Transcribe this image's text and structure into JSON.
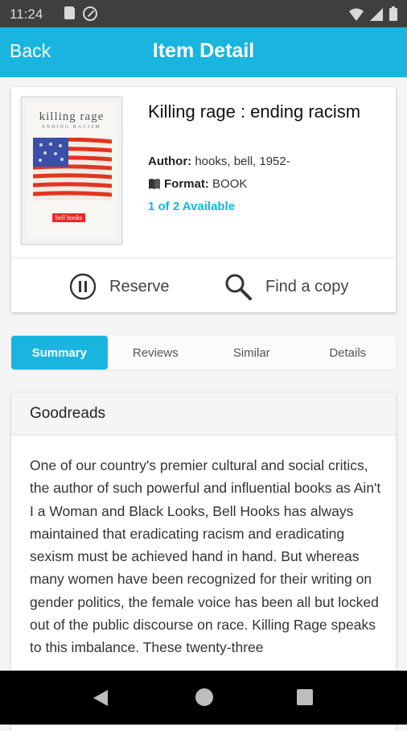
{
  "status_bar": {
    "time": "11:24"
  },
  "header": {
    "back_label": "Back",
    "title": "Item Detail"
  },
  "item": {
    "title": "Killing rage : ending racism",
    "author_label": "Author:",
    "author_value": "hooks, bell, 1952-",
    "format_label": "Format:",
    "format_value": "BOOK",
    "availability": "1 of 2 Available",
    "cover": {
      "title": "killing rage",
      "subtitle": "ENDING RACISM",
      "author": "bell hooks"
    }
  },
  "actions": {
    "reserve_label": "Reserve",
    "find_label": "Find a copy"
  },
  "tabs": [
    {
      "label": "Summary",
      "active": true
    },
    {
      "label": "Reviews",
      "active": false
    },
    {
      "label": "Similar",
      "active": false
    },
    {
      "label": "Details",
      "active": false
    }
  ],
  "summary": {
    "heading": "Goodreads",
    "text": "One of our country's premier cultural and social critics, the author of such powerful and influential books as Ain't I a Woman and Black Looks, Bell Hooks has always maintained that eradicating racism and eradicating sexism must be achieved hand in hand. But whereas many women have been recognized for their writing on gender politics, the female voice has been all but locked out of the public discourse on race. Killing Rage speaks to this imbalance. These twenty-three"
  },
  "colors": {
    "accent": "#19b5df",
    "status_bar": "#3f3f3f",
    "nav_bar": "#000000"
  },
  "icons": {
    "reserve": "pause-circle-icon",
    "find": "search-icon",
    "format": "book-icon"
  }
}
